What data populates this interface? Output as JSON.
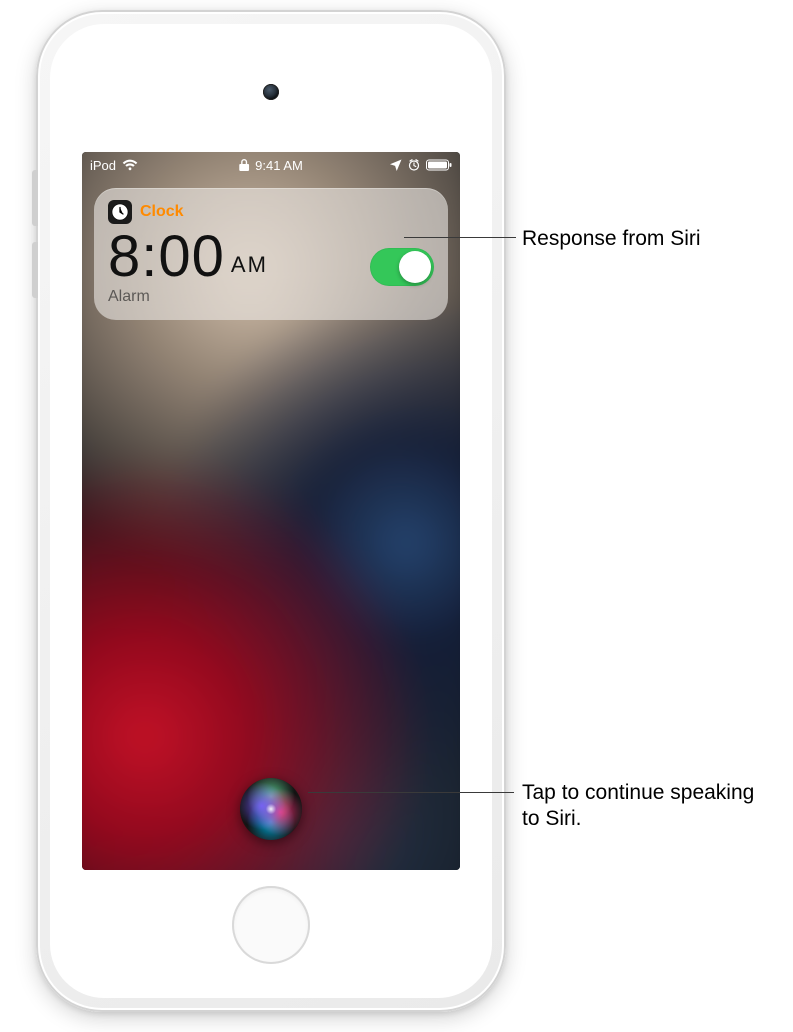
{
  "status": {
    "carrier": "iPod",
    "time": "9:41 AM"
  },
  "notification": {
    "app_name": "Clock",
    "time_value": "8:00",
    "time_ampm": "AM",
    "subtitle": "Alarm",
    "toggle_on": true
  },
  "callouts": {
    "response": "Response from Siri",
    "tap_continue": "Tap to continue speaking to Siri."
  }
}
